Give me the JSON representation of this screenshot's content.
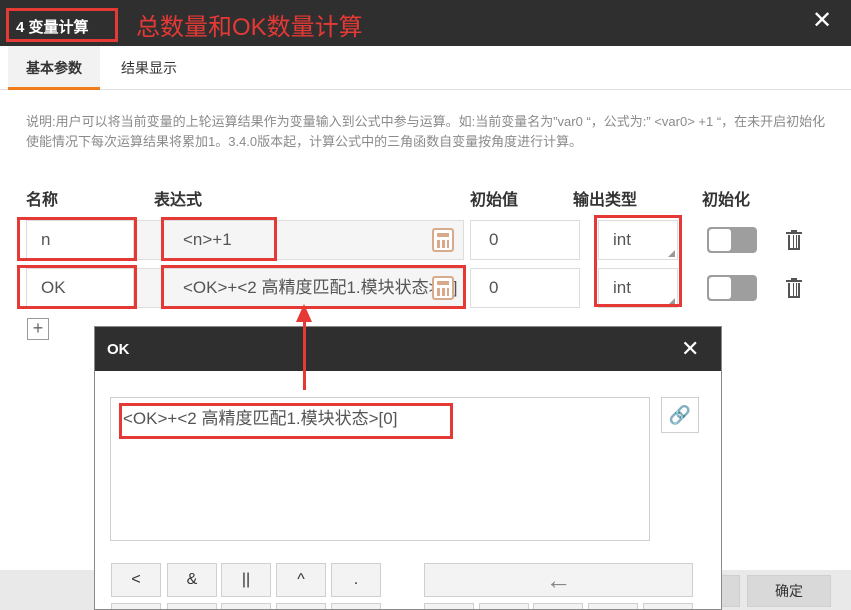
{
  "dialog": {
    "title": "4 变量计算",
    "annotation": "总数量和OK数量计算",
    "close_glyph": "✕"
  },
  "tabs": [
    {
      "label": "基本参数",
      "active": true
    },
    {
      "label": "结果显示",
      "active": false
    }
  ],
  "description": "说明:用户可以将当前变量的上轮运算结果作为变量输入到公式中参与运算。如:当前变量名为”var0 “，公式为:” <var0> +1 “，在未开启初始化使能情况下每次运算结果将累加1。3.4.0版本起，计算公式中的三角函数自变量按角度进行计算。",
  "columns": {
    "name": "名称",
    "expression": "表达式",
    "initial": "初始值",
    "output_type": "输出类型",
    "init": "初始化"
  },
  "rows": [
    {
      "name": "n",
      "expression": "<n>+1",
      "initial": "0",
      "type": "int",
      "init_enabled": false
    },
    {
      "name": "OK",
      "expression": "<OK>+<2 高精度匹配1.模块状态>[0]",
      "initial": "0",
      "type": "int",
      "init_enabled": false
    }
  ],
  "add_button": "+",
  "footer": {
    "confirm": "确定"
  },
  "sub_dialog": {
    "title": "OK",
    "close_glyph": "✕",
    "expression": "<OK>+<2 高精度匹配1.模块状态>[0]",
    "link_icon": "link-icon",
    "keys_row1": [
      "<",
      "&",
      "||",
      "^",
      "."
    ],
    "backspace": "←"
  },
  "colors": {
    "annotation_red": "#e53935",
    "titlebar": "#2f2f2f",
    "tab_accent": "#f07c1e"
  }
}
